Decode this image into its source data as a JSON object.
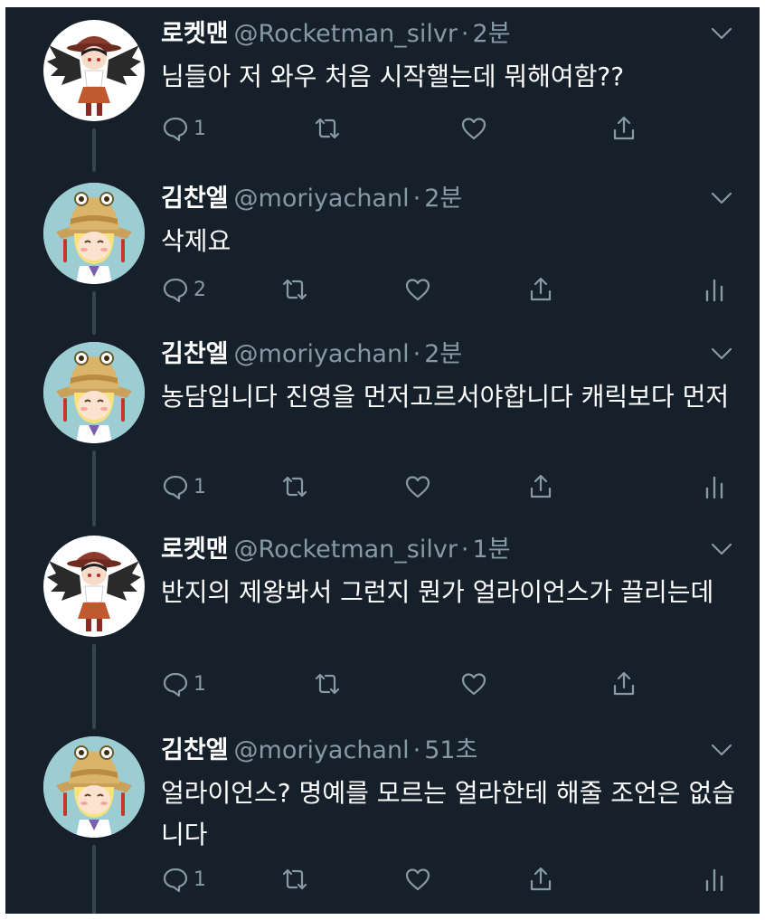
{
  "tweets": [
    {
      "name": "로켓맨",
      "handle": "@Rocketman_silvr",
      "time": "2분",
      "text": "님들아 저 와우 처음 시작핼는데 뭐해여함??",
      "reply_count": "1",
      "avatar": "rocketman-avatar",
      "has_analytics": false
    },
    {
      "name": "김찬엘",
      "handle": "@moriyachanl",
      "time": "2분",
      "text": "삭제요",
      "reply_count": "2",
      "avatar": "moriya-avatar",
      "has_analytics": true
    },
    {
      "name": "김찬엘",
      "handle": "@moriyachanl",
      "time": "2분",
      "text": "농담입니다 진영을 먼저고르서야합니다 캐릭보다 먼저",
      "reply_count": "1",
      "avatar": "moriya-avatar",
      "has_analytics": true
    },
    {
      "name": "로켓맨",
      "handle": "@Rocketman_silvr",
      "time": "1분",
      "text": "반지의 제왕봐서 그런지 뭔가 얼라이언스가 끌리는데",
      "reply_count": "1",
      "avatar": "rocketman-avatar",
      "has_analytics": false
    },
    {
      "name": "김찬엘",
      "handle": "@moriyachanl",
      "time": "51초",
      "text": "얼라이언스? 명예를 모르는 얼라한테 해줄 조언은 없습니다",
      "reply_count": "1",
      "avatar": "moriya-avatar",
      "has_analytics": true
    }
  ],
  "colors": {
    "background": "#15202b",
    "text_primary": "#ffffff",
    "text_secondary": "#8899a6",
    "thread_line": "#38444d"
  },
  "icons": [
    "reply-icon",
    "retweet-icon",
    "like-icon",
    "share-icon",
    "analytics-icon",
    "chevron-down-icon"
  ]
}
